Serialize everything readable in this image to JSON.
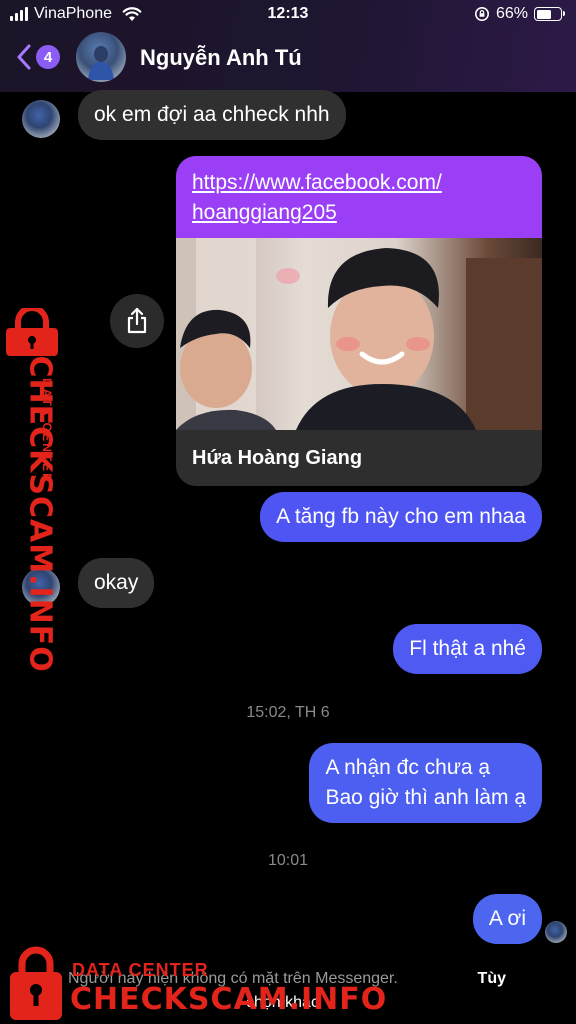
{
  "status_bar": {
    "carrier": "VinaPhone",
    "time": "12:13",
    "battery": "66%",
    "battery_level": 0.66
  },
  "header": {
    "back_badge": "4",
    "contact_name": "Nguyễn Anh Tú"
  },
  "messages": {
    "m1": "ok em đợi aa chheck nhh",
    "link_url_line1": "https://www.facebook.com/",
    "link_url_line2": "hoanggiang205",
    "link_title": "Hứa Hoàng Giang",
    "m2": "A tăng fb này cho em nhaa",
    "m3": "okay",
    "m4": "Fl thật a nhé",
    "ts1": "15:02, TH 6",
    "m5_line1": "A nhận đc chưa ạ",
    "m5_line2": "Bao giờ thì anh làm ạ",
    "ts2": "10:01",
    "m6": "A ơi"
  },
  "footer": {
    "notice_line1": "Người này hiện không có mặt trên Messenger.",
    "notice_action": "Tùy",
    "notice_line2": "chọn khác"
  },
  "watermark": {
    "top_text": "DATA CENTER",
    "main_text": "CHECKSCAM.INFO"
  },
  "colors": {
    "outgoing_bubble": "#5a4cf0",
    "outgoing_bubble_alt": "#4e5af2",
    "incoming_bubble": "#303030",
    "link_header": "#9a3ff5",
    "accent_badge": "#8b5cf6",
    "watermark_red": "#e3241b"
  }
}
